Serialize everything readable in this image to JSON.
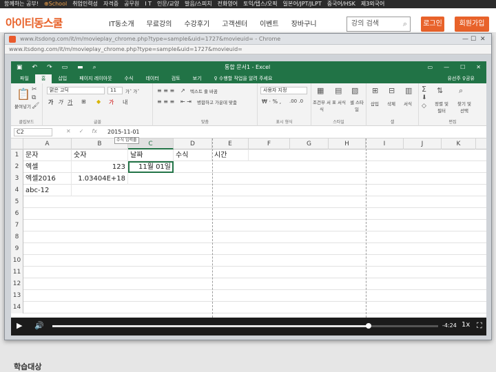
{
  "top_bar": {
    "items": [
      "함께하는 공부!",
      "⊕School",
      "취업인력성",
      "자격증",
      "공무원",
      "I T",
      "인문/교양",
      "발음/스피치",
      "전화영어",
      "토익/텝스/오픽",
      "일본어/JPT/JLPT",
      "중국어/HSK",
      "제3외국어"
    ]
  },
  "site_header": {
    "logo": "아이티동스쿨",
    "nav": [
      "IT동소개",
      "무료강의",
      "수강후기",
      "고객센터",
      "이벤트",
      "장바구니"
    ],
    "search": {
      "placeholder": "강의 검색"
    },
    "login": "로그인",
    "join": "회원가입"
  },
  "popup": {
    "title": "www.itsdong.com/it/m/movieplay_chrome.php?type=sample&uid=1727&movieuid= - Chrome",
    "url": "www.itsdong.com/it/m/movieplay_chrome.php?type=sample&uid=1727&movieuid="
  },
  "excel": {
    "title": "통합 문서1 - Excel",
    "tabs": [
      "파일",
      "홈",
      "삽입",
      "페이지 레이아웃",
      "수식",
      "데이터",
      "검토",
      "보기",
      "♀ 수행할 작업을 알려 주세요"
    ],
    "user": "유선주  ♀공유",
    "ribbon": {
      "clipboard": "클립보드",
      "paste": "붙여넣기",
      "font_name": "맑은 고딕",
      "font_size": "11",
      "font_group": "글꼴",
      "wrap_text": "텍스트 줄 바꿈",
      "merge_center": "병합하고 가운데 맞춤",
      "align_group": "맞춤",
      "number_format": "사용자 지정",
      "number_group": "표시 형식",
      "cond_format": "조건부 서식",
      "table_format": "표 서식",
      "cell_style": "셀 스타일",
      "style_group": "스타일",
      "insert": "삽입",
      "delete": "삭제",
      "format": "서식",
      "cells_group": "셀",
      "sort_filter": "정렬 및 필터",
      "find_select": "찾기 및 선택",
      "edit_group": "편집"
    },
    "name_box": "C2",
    "formula": "2015-11-01",
    "tooltip": "수식 입력줄",
    "columns": [
      "A",
      "B",
      "C",
      "D",
      "E",
      "F",
      "G",
      "H",
      "I",
      "J",
      "K"
    ],
    "rows": [
      {
        "num": "1",
        "cells": [
          "문자",
          "숫자",
          "날짜",
          "수식",
          "시간"
        ]
      },
      {
        "num": "2",
        "cells": [
          "엑셀",
          "123",
          "11월 01일",
          "",
          ""
        ]
      },
      {
        "num": "3",
        "cells": [
          "엑셀2016",
          "1.03404E+18",
          "",
          "",
          ""
        ]
      },
      {
        "num": "4",
        "cells": [
          "abc-12",
          "",
          "",
          "",
          ""
        ]
      },
      {
        "num": "5",
        "cells": []
      },
      {
        "num": "6",
        "cells": []
      },
      {
        "num": "7",
        "cells": []
      },
      {
        "num": "8",
        "cells": []
      },
      {
        "num": "9",
        "cells": []
      },
      {
        "num": "10",
        "cells": []
      },
      {
        "num": "11",
        "cells": []
      },
      {
        "num": "12",
        "cells": []
      },
      {
        "num": "13",
        "cells": []
      },
      {
        "num": "14",
        "cells": []
      }
    ]
  },
  "player": {
    "remaining_time": "-4:24",
    "speed": "1x",
    "progress": 0.82
  },
  "section_title": "학습대상"
}
